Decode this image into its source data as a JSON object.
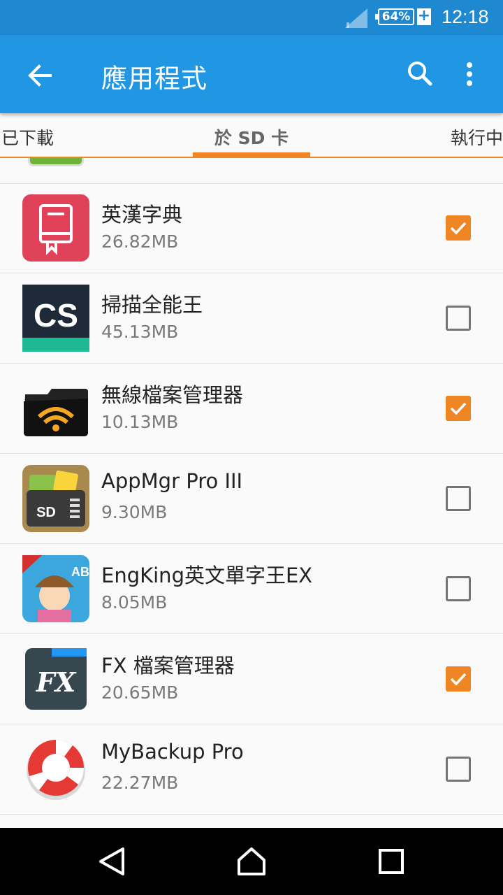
{
  "status_bar": {
    "battery": "64%",
    "charge_symbol": "+",
    "time": "12:18",
    "signal_icon": "signal-icon"
  },
  "app_bar": {
    "title": "應用程式",
    "back_icon": "arrow-back-icon",
    "search_icon": "search-icon",
    "more_icon": "more-vert-icon",
    "color": "#2196e3"
  },
  "tabs": [
    {
      "label": "已下載"
    },
    {
      "label": "於 SD 卡",
      "selected": true
    },
    {
      "label": "執行中"
    }
  ],
  "accent_color": "#f08524",
  "apps": [
    {
      "name": "英漢字典",
      "size": "26.82MB",
      "checked": true,
      "icon": "dictionary-icon"
    },
    {
      "name": "掃描全能王",
      "size": "45.13MB",
      "checked": false,
      "icon": "camscanner-icon"
    },
    {
      "name": "無線檔案管理器",
      "size": "10.13MB",
      "checked": true,
      "icon": "wifi-folder-icon"
    },
    {
      "name": "AppMgr Pro III",
      "size": "9.30MB",
      "checked": false,
      "icon": "sd-folder-icon"
    },
    {
      "name": "EngKing英文單字王EX",
      "size": "8.05MB",
      "checked": false,
      "icon": "engking-icon"
    },
    {
      "name": "FX 檔案管理器",
      "size": "20.65MB",
      "checked": true,
      "icon": "fx-icon"
    },
    {
      "name": "MyBackup Pro",
      "size": "22.27MB",
      "checked": false,
      "icon": "lifebuoy-icon"
    }
  ],
  "nav": {
    "back_icon": "nav-back-icon",
    "home_icon": "nav-home-icon",
    "recents_icon": "nav-recents-icon"
  }
}
